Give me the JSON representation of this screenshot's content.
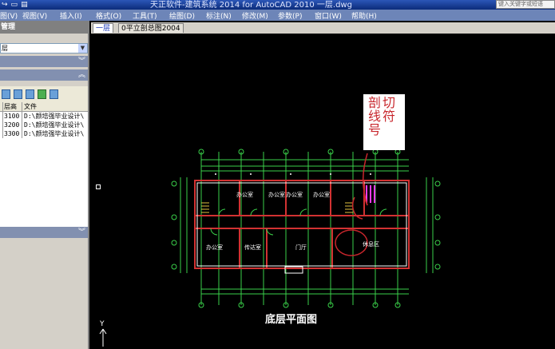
{
  "titlebar": {
    "title": "天正软件-建筑系统 2014   for AutoCAD 2010   一层.dwg",
    "search_placeholder": "键入关键字或短语"
  },
  "menu": [
    "图(V)",
    "视图(V)",
    "插入(I)",
    "格式(O)",
    "工具(T)",
    "绘图(D)",
    "标注(N)",
    "修改(M)",
    "参数(P)",
    "窗口(W)",
    "帮助(H)"
  ],
  "left_panel": {
    "title": "管理",
    "combo_value": "层",
    "table": {
      "headers": [
        "层高",
        "文件"
      ],
      "rows": [
        [
          "3100",
          "D:\\颜培强毕业设计\\"
        ],
        [
          "3200",
          "D:\\颜培强毕业设计\\"
        ],
        [
          "3300",
          "D:\\颜培强毕业设计\\"
        ]
      ]
    }
  },
  "tabs": [
    {
      "label": "一层",
      "active": true
    },
    {
      "label": "0平立剖总图2004",
      "active": false
    }
  ],
  "drawing": {
    "rooms": [
      "办公室",
      "办公室",
      "办公室",
      "办公室",
      "办公室",
      "传达室",
      "门厅",
      "休息区"
    ],
    "caption": "底层平面图",
    "ucs_label": "Y"
  },
  "annotation": {
    "chars": [
      "剖",
      "切",
      "线",
      "符",
      "号"
    ]
  },
  "colors": {
    "menubar": "#6d85b8",
    "canvas": "#000000",
    "annotation_text": "#c8262c",
    "cad_green": "#3ad14a",
    "cad_red": "#d23232",
    "cad_magenta": "#ff3cff"
  }
}
